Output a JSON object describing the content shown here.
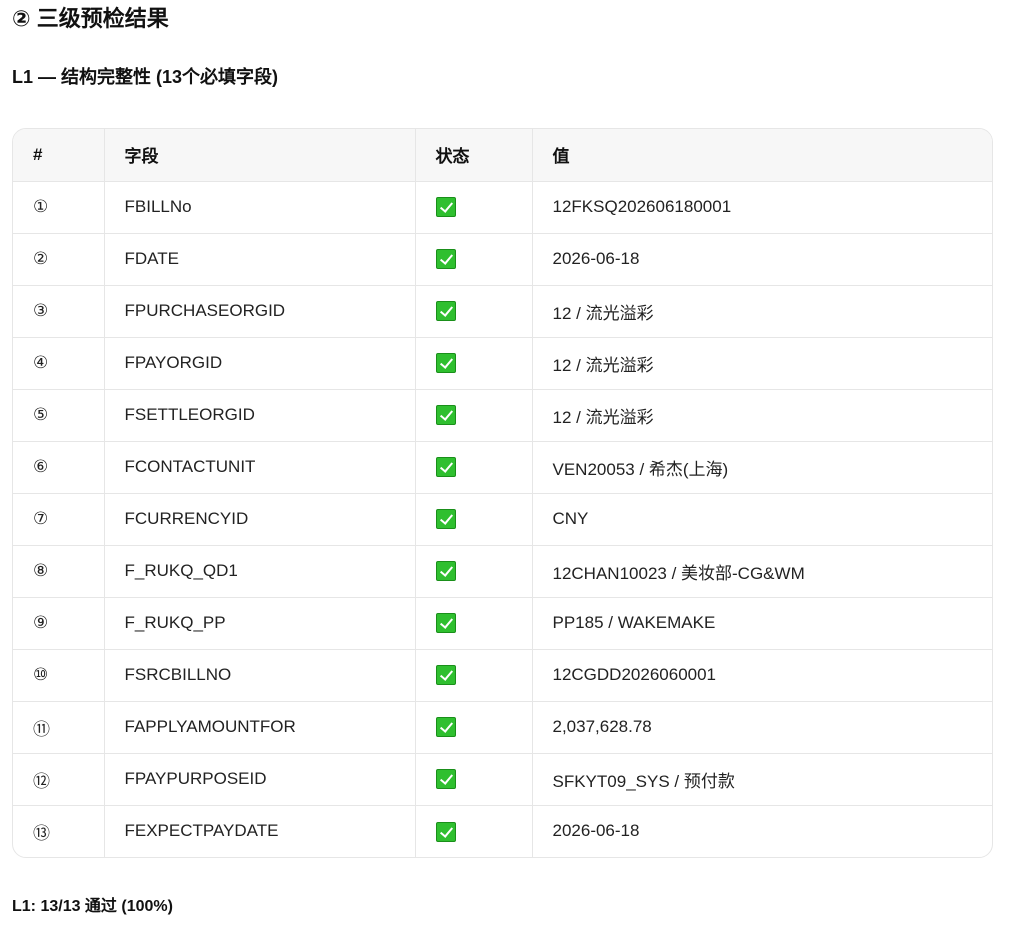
{
  "section": {
    "title": "② 三级预检结果"
  },
  "l1": {
    "subtitle": "L1 — 结构完整性 (13个必填字段)",
    "table": {
      "headers": [
        "#",
        "字段",
        "状态",
        "值"
      ],
      "rows": [
        {
          "num": "①",
          "field": "FBILLNo",
          "status_icon": "check-mark-icon",
          "value": "12FKSQ202606180001"
        },
        {
          "num": "②",
          "field": "FDATE",
          "status_icon": "check-mark-icon",
          "value": "2026-06-18"
        },
        {
          "num": "③",
          "field": "FPURCHASEORGID",
          "status_icon": "check-mark-icon",
          "value": "12 / 流光溢彩"
        },
        {
          "num": "④",
          "field": "FPAYORGID",
          "status_icon": "check-mark-icon",
          "value": "12 / 流光溢彩"
        },
        {
          "num": "⑤",
          "field": "FSETTLEORGID",
          "status_icon": "check-mark-icon",
          "value": "12 / 流光溢彩"
        },
        {
          "num": "⑥",
          "field": "FCONTACTUNIT",
          "status_icon": "check-mark-icon",
          "value": "VEN20053 / 希杰(上海)"
        },
        {
          "num": "⑦",
          "field": "FCURRENCYID",
          "status_icon": "check-mark-icon",
          "value": "CNY"
        },
        {
          "num": "⑧",
          "field": "F_RUKQ_QD1",
          "status_icon": "check-mark-icon",
          "value": "12CHAN10023 / 美妆部-CG&WM"
        },
        {
          "num": "⑨",
          "field": "F_RUKQ_PP",
          "status_icon": "check-mark-icon",
          "value": "PP185 / WAKEMAKE"
        },
        {
          "num": "⑩",
          "field": "FSRCBILLNO",
          "status_icon": "check-mark-icon",
          "value": "12CGDD2026060001"
        },
        {
          "num": "⑪",
          "field": "FAPPLYAMOUNTFOR",
          "status_icon": "check-mark-icon",
          "value": "2,037,628.78"
        },
        {
          "num": "⑫",
          "field": "FPAYPURPOSEID",
          "status_icon": "check-mark-icon",
          "value": "SFKYT09_SYS / 预付款"
        },
        {
          "num": "⑬",
          "field": "FEXPECTPAYDATE",
          "status_icon": "check-mark-icon",
          "value": "2026-06-18"
        }
      ]
    },
    "summary": "L1: 13/13 通过 (100%)"
  },
  "colors": {
    "check_green": "#2fbf2f",
    "header_bg": "#f7f7f7",
    "border": "#e6e6e6"
  }
}
